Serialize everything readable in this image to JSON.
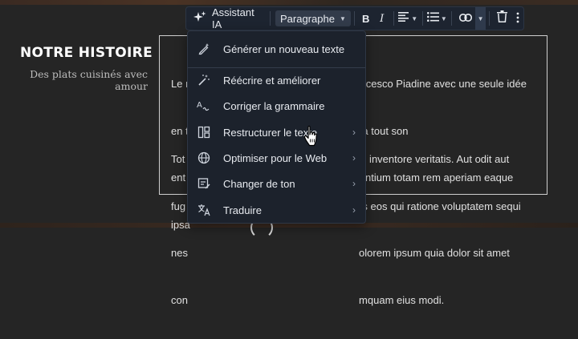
{
  "section": {
    "title": "NOTRE HISTOIRE",
    "subtitle": "Des plats cuisinés avec amour"
  },
  "text_block": {
    "paragraph_1_lines": [
      "Le r                                                         ancesco Piadine avec une seule idée",
      "en t                                                         e à tout son",
      "ent                                                          dantium totam rem aperiam eaque",
      "ipsa"
    ],
    "paragraph_2_lines": [
      "Tot                                                           llo inventore veritatis. Aut odit aut",
      "fug                                                           es eos qui ratione voluptatem sequi",
      "nes                                                           olorem ipsum quia dolor sit amet",
      "con                                                           mquam eius modi."
    ]
  },
  "toolbar": {
    "assistant_label": "Assistant IA",
    "format_select_value": "Paragraphe",
    "icons": {
      "assistant": "sparkle-icon",
      "bold": "bold-icon",
      "italic": "italic-icon",
      "align": "align-left-icon",
      "list": "bulleted-list-icon",
      "link": "link-icon",
      "delete": "trash-icon",
      "more": "more-vertical-icon"
    }
  },
  "menu": {
    "items": [
      {
        "label": "Générer un nouveau texte",
        "icon": "pen-sparkle-icon",
        "has_submenu": false
      },
      {
        "label": "Réécrire et améliorer",
        "icon": "magic-wand-icon",
        "has_submenu": false
      },
      {
        "label": "Corriger la grammaire",
        "icon": "spellcheck-icon",
        "has_submenu": false
      },
      {
        "label": "Restructurer le texte",
        "icon": "layout-icon",
        "has_submenu": true
      },
      {
        "label": "Optimiser pour le Web",
        "icon": "globe-icon",
        "has_submenu": true
      },
      {
        "label": "Changer de ton",
        "icon": "tone-icon",
        "has_submenu": true
      },
      {
        "label": "Traduire",
        "icon": "translate-icon",
        "has_submenu": true
      }
    ]
  },
  "colors": {
    "page_background": "#252525",
    "toolbar_background": "#1d2430",
    "menu_background": "#1c222c",
    "select_background": "#323b4a"
  }
}
